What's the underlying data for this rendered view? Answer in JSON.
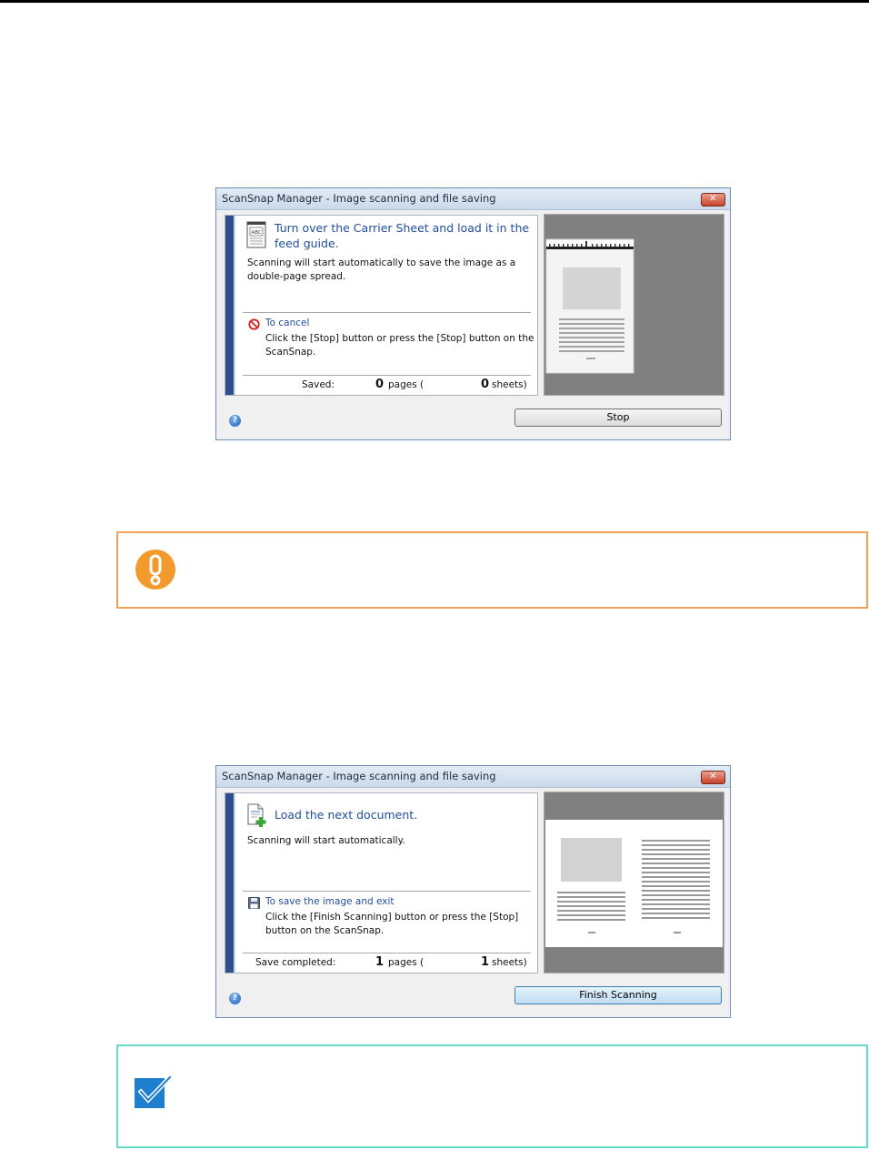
{
  "dialog1": {
    "title": "ScanSnap Manager - Image scanning and file saving",
    "heading_line1": "Turn over the Carrier Sheet and load it in the",
    "heading_line2": "feed guide.",
    "desc_line1": "Scanning will start automatically to save the image as a",
    "desc_line2": "double-page spread.",
    "cancel_label": "To cancel",
    "cancel_line1": "Click the [Stop] button or press the [Stop] button on the",
    "cancel_line2": "ScanSnap.",
    "status_label": "Saved:",
    "pages_count": "0",
    "pages_label": "pages (",
    "sheets_count": "0",
    "sheets_label": "sheets)",
    "button_label": "Stop",
    "doc_icon_text": "ABC"
  },
  "dialog2": {
    "title": "ScanSnap Manager - Image scanning and file saving",
    "heading": "Load the next document.",
    "desc": "Scanning will start automatically.",
    "save_label": "To save the image and exit",
    "save_line1": "Click the [Finish Scanning] button or press the [Stop]",
    "save_line2": "button on the ScanSnap.",
    "status_label": "Save completed:",
    "pages_count": "1",
    "pages_label": "pages (",
    "sheets_count": "1",
    "sheets_label": "sheets)",
    "button_label": "Finish Scanning"
  },
  "icons": {
    "close": "close-icon",
    "help": "help-icon",
    "document": "document-icon",
    "add_document": "add-document-icon",
    "cancel": "no-entry-icon",
    "save": "floppy-disk-icon",
    "warning": "exclamation-icon",
    "check": "checkmark-icon"
  },
  "colors": {
    "accent_blue": "#2e4f8f",
    "heading_blue": "#1f4e9c",
    "warning_orange": "#f39a2c",
    "note_orange_border": "#f0a05a",
    "note_cyan_border": "#66dbcc",
    "check_blue": "#1e7fcf"
  }
}
